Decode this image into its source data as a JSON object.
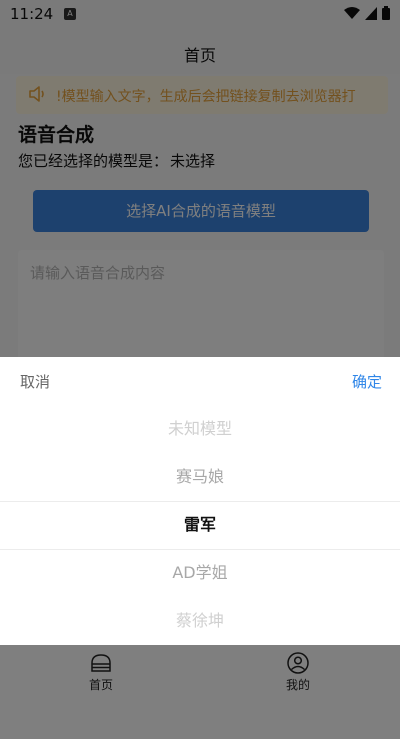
{
  "status_bar": {
    "time": "11:24",
    "app_badge": "A"
  },
  "header": {
    "title": "首页"
  },
  "notice": {
    "text": "!模型输入文字，生成后会把链接复制去浏览器打"
  },
  "main": {
    "section_title": "语音合成",
    "model_label": "您已经选择的模型是：",
    "model_value": "未选择",
    "select_button": "选择AI合成的语音模型",
    "textarea_placeholder": "请输入语音合成内容"
  },
  "picker": {
    "cancel": "取消",
    "confirm": "确定",
    "options": [
      "未知模型",
      "赛马娘",
      "雷军",
      "AD学姐",
      "蔡徐坤"
    ],
    "selected_index": 2
  },
  "tabbar": {
    "items": [
      {
        "label": "首页",
        "icon": "home-icon"
      },
      {
        "label": "我的",
        "icon": "user-icon"
      }
    ]
  },
  "colors": {
    "primary": "#3b82dc",
    "confirm": "#2f86e8",
    "notice_text": "#e6a23c",
    "notice_bg": "#fff7e0"
  }
}
